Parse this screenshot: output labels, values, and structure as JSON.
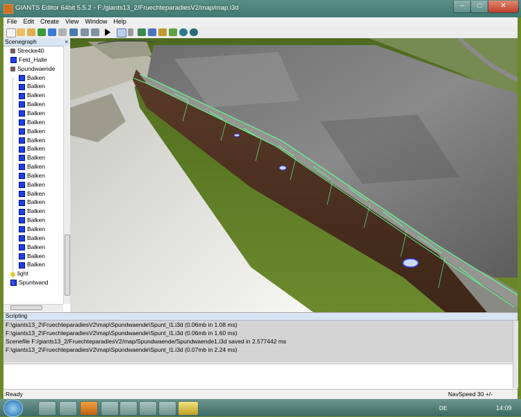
{
  "window": {
    "title": "GIANTS Editor 64bit 5.5.2 - F:/giants13_2/FruechteparadiesV2/map/map.i3d"
  },
  "window_controls": {
    "minimize": "–",
    "maximize": "□",
    "close": "✕"
  },
  "menu": [
    "File",
    "Edit",
    "Create",
    "View",
    "Window",
    "Help"
  ],
  "scenegraph": {
    "title": "Scenegraph",
    "close": "×",
    "items": [
      {
        "label": "Strecke40",
        "icon": "transform-group-icon"
      },
      {
        "label": "Feld_Halle",
        "icon": "shape-icon"
      },
      {
        "label": "Spundwaende",
        "icon": "transform-group-icon"
      },
      {
        "label": "Balken",
        "icon": "shape-icon"
      },
      {
        "label": "Balken",
        "icon": "shape-icon"
      },
      {
        "label": "Balken",
        "icon": "shape-icon"
      },
      {
        "label": "Balken",
        "icon": "shape-icon"
      },
      {
        "label": "Balken",
        "icon": "shape-icon"
      },
      {
        "label": "Balken",
        "icon": "shape-icon"
      },
      {
        "label": "Balken",
        "icon": "shape-icon"
      },
      {
        "label": "Balken",
        "icon": "shape-icon"
      },
      {
        "label": "Balken",
        "icon": "shape-icon"
      },
      {
        "label": "Balken",
        "icon": "shape-icon"
      },
      {
        "label": "Balken",
        "icon": "shape-icon"
      },
      {
        "label": "Balken",
        "icon": "shape-icon"
      },
      {
        "label": "Balken",
        "icon": "shape-icon"
      },
      {
        "label": "Balken",
        "icon": "shape-icon"
      },
      {
        "label": "Balken",
        "icon": "shape-icon"
      },
      {
        "label": "Balken",
        "icon": "shape-icon"
      },
      {
        "label": "Balken",
        "icon": "shape-icon"
      },
      {
        "label": "Balken",
        "icon": "shape-icon"
      },
      {
        "label": "Balken",
        "icon": "shape-icon"
      },
      {
        "label": "Balken",
        "icon": "shape-icon"
      },
      {
        "label": "Balken",
        "icon": "shape-icon"
      },
      {
        "label": "Balken",
        "icon": "shape-icon"
      },
      {
        "label": "light",
        "icon": "light-bulb-icon"
      },
      {
        "label": "Spuntwand",
        "icon": "shape-icon"
      }
    ]
  },
  "scripting": {
    "title": "Scripting",
    "log": [
      "F:\\giants13_2\\FruechteparadiesV2\\map\\Spundwaende\\Spunt_l1.i3d (0.06mb in 1.08 ms)",
      "F:\\giants13_2\\FruechteparadiesV2\\map\\Spundwaende\\Spunt_l1.i3d (0.06mb in 1.60 ms)",
      "Scenefile F:/giants13_2/FruechteparadiesV2/map/Spundwaende/Spundwaende1.i3d saved in 2.577442 ms",
      "F:\\giants13_2\\FruechteparadiesV2\\map\\Spundwaende\\Spunt_l1.i3d (0.07mb in 2.24 ms)"
    ]
  },
  "status": {
    "left": "Ready",
    "navspeed": "NavSpeed 30 +/-"
  },
  "taskbar": {
    "lang": "DE",
    "time": "14:09"
  },
  "colors": {
    "selection": "#5eff8f",
    "titlebar": "#4a8278"
  }
}
